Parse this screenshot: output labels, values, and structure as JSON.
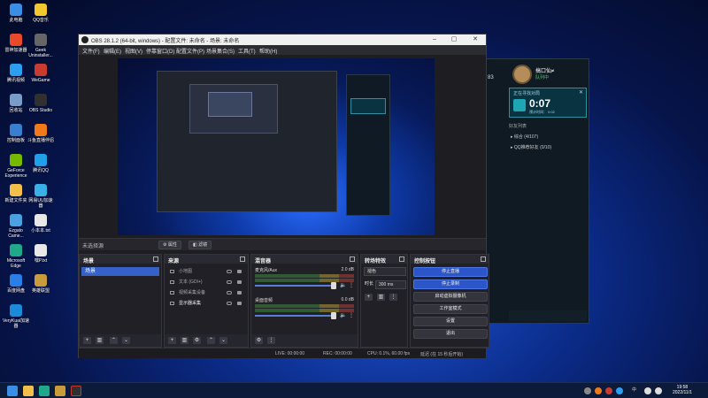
{
  "desktop": {
    "icons": [
      {
        "label": "此电脑",
        "color": "#3a8ee6"
      },
      {
        "label": "QQ音乐",
        "color": "#f3c72f"
      },
      {
        "label": "雷神加速器",
        "color": "#e84a2b"
      },
      {
        "label": "Geek Uninstaller...",
        "color": "#666666"
      },
      {
        "label": "腾讯视频",
        "color": "#2c9ff0"
      },
      {
        "label": "WeGame",
        "color": "#c93a2f"
      },
      {
        "label": "回收站",
        "color": "#7a9cc8"
      },
      {
        "label": "OBS Studio",
        "color": "#303030"
      },
      {
        "label": "控制面板",
        "color": "#3a7ed0"
      },
      {
        "label": "斗鱼直播伴侣",
        "color": "#f07a1a"
      },
      {
        "label": "GeForce Experience",
        "color": "#76b900"
      },
      {
        "label": "腾讯QQ",
        "color": "#1fa0e8"
      },
      {
        "label": "新建文件夹",
        "color": "#f2c04a"
      },
      {
        "label": "网易UU加速器",
        "color": "#3ab0e8"
      },
      {
        "label": "Ezgato Came...",
        "color": "#4aa0e0"
      },
      {
        "label": "小本本.txt",
        "color": "#e8e8e8"
      },
      {
        "label": "Microsoft Edge",
        "color": "#1fa88a"
      },
      {
        "label": "嘿P.txt",
        "color": "#e8e8e8"
      },
      {
        "label": "百度网盘",
        "color": "#2a7fe6"
      },
      {
        "label": "英雄联盟",
        "color": "#c89b3c"
      },
      {
        "label": "VeryKuai加速器",
        "color": "#1c8ad8"
      }
    ]
  },
  "game_client": {
    "player_name": "搞口仙≠",
    "status": "队列中",
    "side_number": "83",
    "match_title": "正在寻找对局",
    "match_timer": "0:07",
    "match_sub": "预计时间： 0:02",
    "section": "好友列表",
    "list_items": [
      "▸ 综合 (4/107)",
      "▸ QQ推荐好友 (0/10)"
    ]
  },
  "obs": {
    "window_title": "OBS 28.1.2 (64-bit, windows) - 配置文件: 未命名 - 场景: 未命名",
    "menu": [
      "文件(F)",
      "编辑(E)",
      "视图(V)",
      "停靠窗口(D)",
      "配置文件(P)",
      "场景集合(S)",
      "工具(T)",
      "帮助(H)"
    ],
    "no_source": "未选择源",
    "props_btn": "⚙ 属性",
    "filters_btn": "◧ 滤镜",
    "scenes": {
      "title": "场景",
      "selected": "场景"
    },
    "sources": {
      "title": "来源",
      "items": [
        {
          "label": "小地图"
        },
        {
          "label": "文本 (GDI+)"
        },
        {
          "label": "视频采集设备"
        },
        {
          "label": "显示器采集"
        }
      ]
    },
    "mixer": {
      "title": "混音器",
      "channels": [
        {
          "label": "麦克风/Aux",
          "db": "2.0 dB"
        },
        {
          "label": "桌面音频",
          "db": "0.0 dB"
        }
      ]
    },
    "transitions": {
      "title": "转场特效",
      "type": "褪色",
      "duration_label": "时长",
      "duration": "300 ms"
    },
    "controls": {
      "title": "控制按钮",
      "stop_stream": "停止直播",
      "stop_record": "停止录制",
      "virtual_cam": "启动虚拟摄像机",
      "studio_mode": "工作室模式",
      "settings": "设置",
      "exit": "退出"
    },
    "status": {
      "live": "LIVE: 00:00:00",
      "rec": "REC: 00:00:00",
      "cpu": "CPU: 0.1%, 60.00 fps",
      "delay": "延迟 (在 15 秒后开始)"
    }
  },
  "taskbar": {
    "tray_lang": "中",
    "time": "19:58",
    "date": "2022/11/1"
  }
}
